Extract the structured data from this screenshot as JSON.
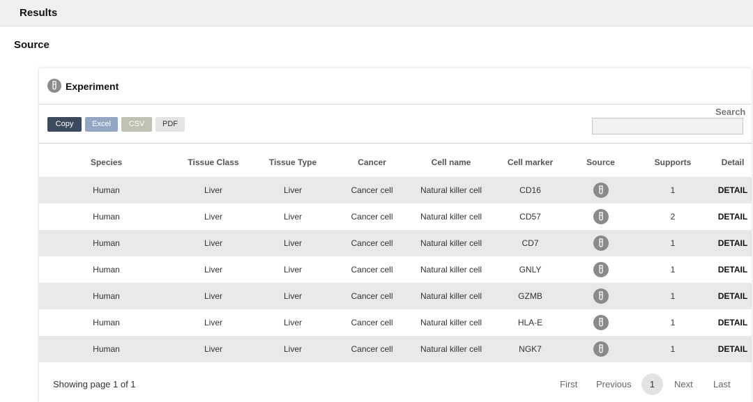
{
  "page": {
    "results_label": "Results",
    "source_label": "Source"
  },
  "panel": {
    "title": "Experiment",
    "icon": "test-tube-icon",
    "buttons": {
      "copy": "Copy",
      "excel": "Excel",
      "csv": "CSV",
      "pdf": "PDF"
    },
    "search": {
      "label": "Search",
      "value": ""
    }
  },
  "table": {
    "columns": [
      "Species",
      "Tissue Class",
      "Tissue Type",
      "Cancer",
      "Cell name",
      "Cell marker",
      "Source",
      "Supports",
      "Detail"
    ],
    "rows": [
      {
        "species": "Human",
        "tissue_class": "Liver",
        "tissue_type": "Liver",
        "cancer": "Cancer cell",
        "cell_name": "Natural killer cell",
        "cell_marker": "CD16",
        "source_icon": "test-tube-icon",
        "supports": "1",
        "detail": "DETAIL"
      },
      {
        "species": "Human",
        "tissue_class": "Liver",
        "tissue_type": "Liver",
        "cancer": "Cancer cell",
        "cell_name": "Natural killer cell",
        "cell_marker": "CD57",
        "source_icon": "test-tube-icon",
        "supports": "2",
        "detail": "DETAIL"
      },
      {
        "species": "Human",
        "tissue_class": "Liver",
        "tissue_type": "Liver",
        "cancer": "Cancer cell",
        "cell_name": "Natural killer cell",
        "cell_marker": "CD7",
        "source_icon": "test-tube-icon",
        "supports": "1",
        "detail": "DETAIL"
      },
      {
        "species": "Human",
        "tissue_class": "Liver",
        "tissue_type": "Liver",
        "cancer": "Cancer cell",
        "cell_name": "Natural killer cell",
        "cell_marker": "GNLY",
        "source_icon": "test-tube-icon",
        "supports": "1",
        "detail": "DETAIL"
      },
      {
        "species": "Human",
        "tissue_class": "Liver",
        "tissue_type": "Liver",
        "cancer": "Cancer cell",
        "cell_name": "Natural killer cell",
        "cell_marker": "GZMB",
        "source_icon": "test-tube-icon",
        "supports": "1",
        "detail": "DETAIL"
      },
      {
        "species": "Human",
        "tissue_class": "Liver",
        "tissue_type": "Liver",
        "cancer": "Cancer cell",
        "cell_name": "Natural killer cell",
        "cell_marker": "HLA-E",
        "source_icon": "test-tube-icon",
        "supports": "1",
        "detail": "DETAIL"
      },
      {
        "species": "Human",
        "tissue_class": "Liver",
        "tissue_type": "Liver",
        "cancer": "Cancer cell",
        "cell_name": "Natural killer cell",
        "cell_marker": "NGK7",
        "source_icon": "test-tube-icon",
        "supports": "1",
        "detail": "DETAIL"
      }
    ]
  },
  "pagination": {
    "showing": "Showing page 1 of 1",
    "first": "First",
    "previous": "Previous",
    "current": "1",
    "next": "Next",
    "last": "Last"
  },
  "colors": {
    "copy": "#3c4a5e",
    "excel": "#94a7c2",
    "csv": "#c1c1b1",
    "pdf": "#e4e4e4",
    "stripe": "#e9e9e9"
  }
}
